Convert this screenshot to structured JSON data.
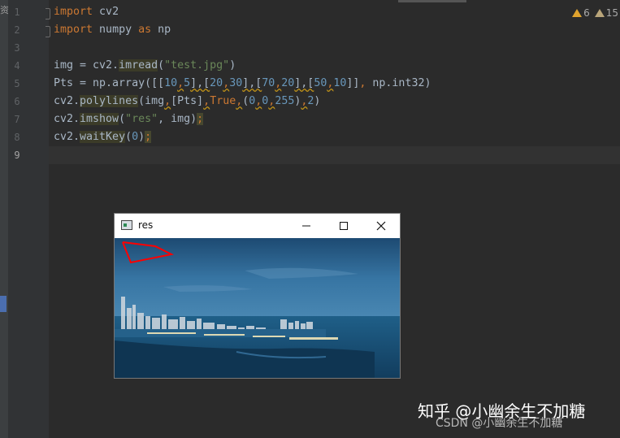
{
  "left_strip": {
    "cut_text": "资"
  },
  "inspections": {
    "warnings": "6",
    "weak_warnings": "15"
  },
  "gutter": {
    "line_numbers": [
      "1",
      "2",
      "3",
      "4",
      "5",
      "6",
      "7",
      "8",
      "9"
    ]
  },
  "code": {
    "l1": {
      "kw": "import",
      "rest": " cv2"
    },
    "l2": {
      "kw1": "import",
      "mid": " numpy ",
      "kw2": "as",
      "rest": " np"
    },
    "l4": {
      "a": "img = cv2.",
      "fn": "imread",
      "b": "(",
      "str": "\"test.jpg\"",
      "c": ")"
    },
    "l5": {
      "a": "Pts = np.array([[",
      "n1": "10",
      "c1": ",",
      "n2": "5",
      "b1": "],[",
      "n3": "20",
      "c2": ",",
      "n4": "30",
      "b2": "],[",
      "n5": "70",
      "c3": ",",
      "n6": "20",
      "b3": "],[",
      "n7": "50",
      "c4": ",",
      "n8": "10",
      "b4": "]]",
      "c5": ",",
      "rest": " np.int32)"
    },
    "l6": {
      "a": "cv2.",
      "fn": "polylines",
      "b": "(img",
      "c1": ",",
      "d": "[Pts]",
      "c2": ",",
      "kw": "True",
      "c3": ",",
      "e": "(",
      "n1": "0",
      "c4": ",",
      "n2": "0",
      "c5": ",",
      "n3": "255",
      "f": ")",
      "c6": ",",
      "n4": "2",
      "g": ")"
    },
    "l7": {
      "a": "cv2.",
      "fn": "imshow",
      "b": "(",
      "str": "\"res\"",
      "c": ", img)",
      "semi": ";"
    },
    "l8": {
      "a": "cv2.",
      "fn": "waitKey",
      "b": "(",
      "n": "0",
      "c": ")",
      "semi": ";"
    }
  },
  "res_window": {
    "title": "res",
    "icons": [
      "app-icon",
      "minimize-icon",
      "maximize-icon",
      "close-icon"
    ]
  },
  "watermark": {
    "main": "知乎 @小幽余生不加糖",
    "sub": "CSDN @小幽余生不加糖"
  },
  "colors": {
    "keyword": "#cc7832",
    "string": "#6a8759",
    "number": "#6897bb",
    "text": "#a9b7c6",
    "background": "#2b2b2b",
    "polyline": "#ff0000"
  }
}
